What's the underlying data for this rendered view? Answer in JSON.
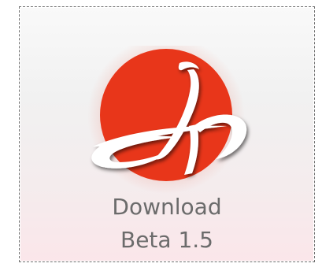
{
  "button": {
    "line1": "Download",
    "line2": "Beta 1.5"
  },
  "logo": {
    "icon": "jp-logo-icon",
    "circle_color": "#e8361a",
    "glyph_color": "#ffffff"
  },
  "colors": {
    "label_text": "#6b6b6b",
    "border": "#6f6f6f"
  }
}
